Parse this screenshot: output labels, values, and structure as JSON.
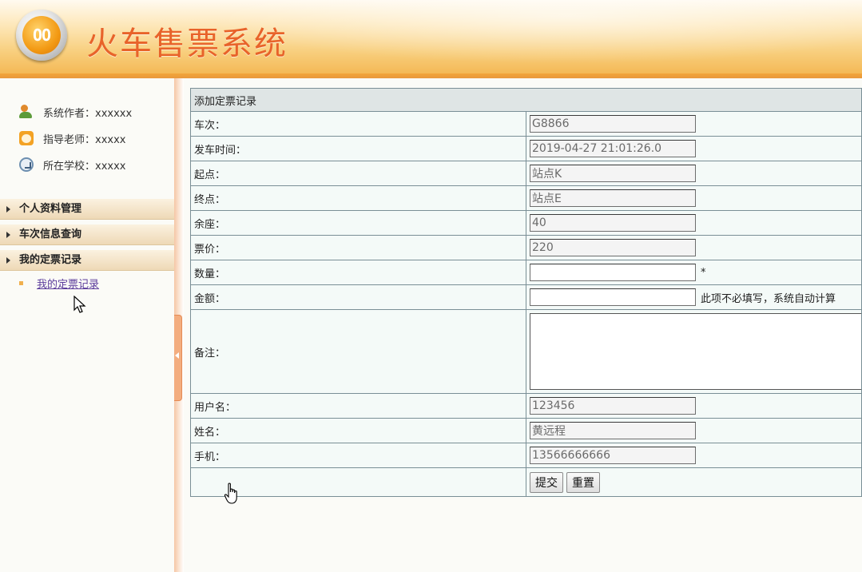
{
  "header": {
    "logo_text": "ОО",
    "title": "火车售票系统"
  },
  "sidebar": {
    "info": [
      {
        "icon": "users-icon",
        "text": "系统作者：xxxxxx"
      },
      {
        "icon": "alarm-clock-icon",
        "text": "指导老师：xxxxx"
      },
      {
        "icon": "globe-icon",
        "text": "所在学校：xxxxx"
      }
    ],
    "nav": [
      {
        "label": "个人资料管理"
      },
      {
        "label": "车次信息查询"
      },
      {
        "label": "我的定票记录"
      }
    ],
    "sub_item": "我的定票记录"
  },
  "form": {
    "caption": "添加定票记录",
    "rows": {
      "train": {
        "label": "车次：",
        "value": "G8866"
      },
      "depart": {
        "label": "发车时间：",
        "value": "2019-04-27 21:01:26.0"
      },
      "origin": {
        "label": "起点：",
        "value": "站点K"
      },
      "dest": {
        "label": "终点：",
        "value": "站点E"
      },
      "seats": {
        "label": "余座：",
        "value": "40"
      },
      "price": {
        "label": "票价：",
        "value": "220"
      },
      "qty": {
        "label": "数量：",
        "value": "",
        "note": "*"
      },
      "amount": {
        "label": "金额：",
        "value": "",
        "note": "此项不必填写，系统自动计算"
      },
      "memo": {
        "label": "备注：",
        "value": ""
      },
      "username": {
        "label": "用户名：",
        "value": "123456"
      },
      "name": {
        "label": "姓名：",
        "value": "黄远程"
      },
      "phone": {
        "label": "手机：",
        "value": "13566666666"
      }
    },
    "submit": "提交",
    "reset": "重置"
  },
  "colors": {
    "title": "#e8632a",
    "header_bar": "#f2a53a",
    "link": "#5c3d9c"
  }
}
